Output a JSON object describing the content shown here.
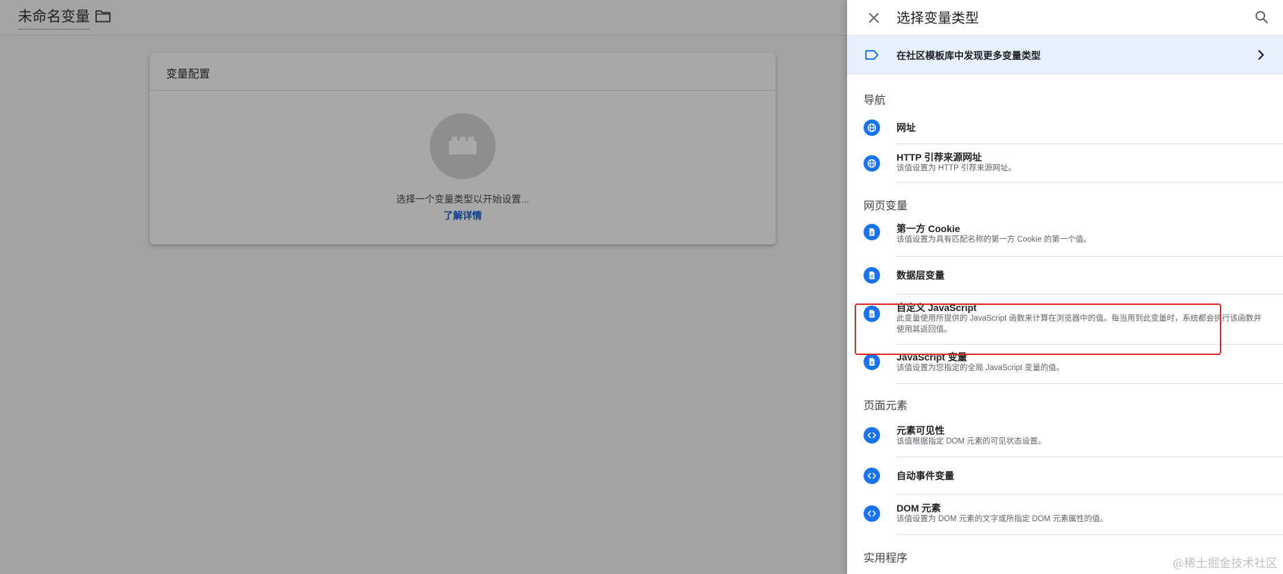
{
  "editor": {
    "variable_name": "未命名变量",
    "config_card_title": "变量配置",
    "config_hint": "选择一个变量类型以开始设置...",
    "learn_more": "了解详情"
  },
  "panel": {
    "title": "选择变量类型",
    "community_banner": "在社区模板库中发现更多变量类型",
    "sections": {
      "navigation": {
        "title": "导航",
        "items": [
          {
            "name": "网址",
            "description": ""
          },
          {
            "name": "HTTP 引荐来源网址",
            "description": "该值设置为 HTTP 引荐来源网址。"
          }
        ]
      },
      "page_variables": {
        "title": "网页变量",
        "items": [
          {
            "name": "第一方 Cookie",
            "description": "该值设置为具有匹配名称的第一方 Cookie 的第一个值。"
          },
          {
            "name": "数据层变量",
            "description": ""
          },
          {
            "name": "自定义 JavaScript",
            "description": "此变量使用所提供的 JavaScript 函数来计算在浏览器中的值。每当用到此变量时，系统都会执行该函数并使用其返回值。"
          },
          {
            "name": "JavaScript 变量",
            "description": "该值设置为您指定的全局 JavaScript 变量的值。"
          }
        ]
      },
      "page_elements": {
        "title": "页面元素",
        "items": [
          {
            "name": "元素可见性",
            "description": "该值根据指定 DOM 元素的可见状态设置。"
          },
          {
            "name": "自动事件变量",
            "description": ""
          },
          {
            "name": "DOM 元素",
            "description": "该值设置为 DOM 元素的文字或所指定 DOM 元素属性的值。"
          }
        ]
      },
      "utilities": {
        "title": "实用程序"
      }
    }
  },
  "watermark": "@稀土掘金技术社区",
  "colors": {
    "accent": "#1a73e8",
    "banner_bg": "#e8f0fe",
    "highlight": "#e02424",
    "overlay": "#a3a3a3"
  },
  "icons": {
    "navigation": "globe-icon",
    "page_variables": "document-icon",
    "page_elements": "code-icon"
  }
}
